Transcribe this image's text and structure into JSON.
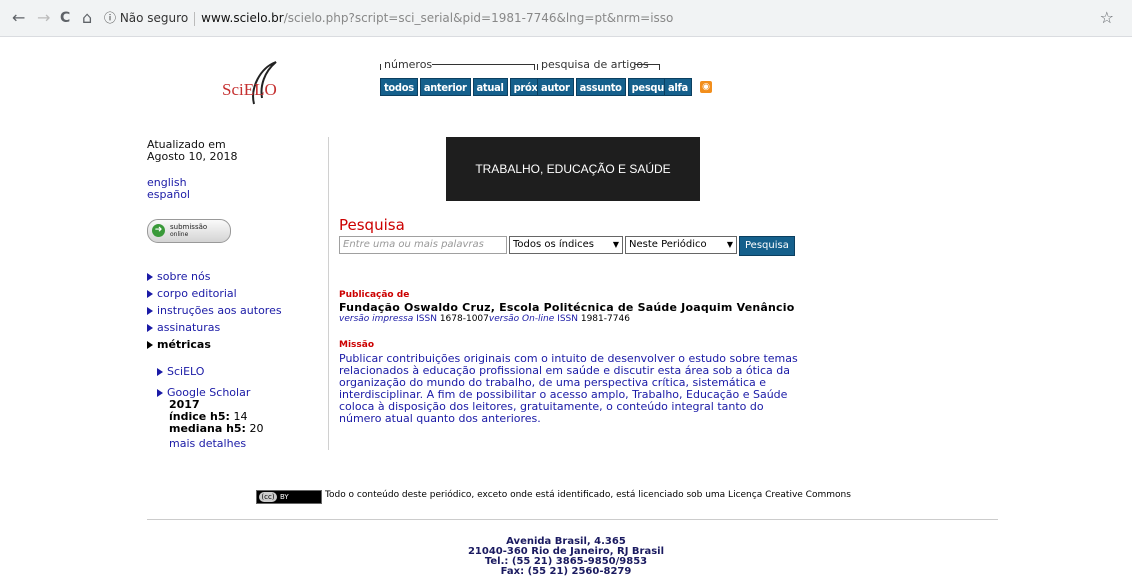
{
  "browser": {
    "back": "←",
    "forward": "→",
    "reload": "C",
    "home": "⌂",
    "security": "ⓘ Não seguro",
    "url_host": "www.scielo.br",
    "url_path": "/scielo.php?script=sci_serial&pid=1981-7746&lng=pt&nrm=isso",
    "star": "☆"
  },
  "logo": {
    "text": "SciELO"
  },
  "nav": {
    "group1_label": "números",
    "group2_label": "pesquisa de artigos",
    "group1": [
      "todos",
      "anterior",
      "atual",
      "próximo"
    ],
    "group2": [
      "autor",
      "assunto",
      "pesquisa"
    ],
    "alfa": "alfa"
  },
  "sidebar": {
    "updated_label": "Atualizado em",
    "updated_date": "Agosto 10, 2018",
    "lang_en": "english",
    "lang_es": "español",
    "submission_line1": "submissão",
    "submission_line2": "online",
    "menu": [
      "sobre nós",
      "corpo editorial",
      "instruções aos autores",
      "assinaturas",
      "métricas"
    ],
    "metrics": {
      "scielo": "SciELO",
      "google": "Google Scholar",
      "year": "2017",
      "h5_label": "índice h5:",
      "h5_value": " 14",
      "median_label": "mediana h5:",
      "median_value": " 20",
      "more": "mais detalhes"
    }
  },
  "banner": {
    "title": "TRABALHO, EDUCAÇÃO E SAÚDE"
  },
  "search": {
    "title": "Pesquisa",
    "placeholder": "Entre uma ou mais palavras",
    "index_select": "Todos os índices",
    "scope_select": "Neste Periódico",
    "button": "Pesquisa"
  },
  "publication": {
    "heading": "Publicação de",
    "publisher": "Fundação Oswaldo Cruz, Escola Politécnica de Saúde Joaquim Venâncio",
    "print_label": "versão impressa",
    "issn_word": "ISSN",
    "print_issn": "1678-1007",
    "online_label": "versão On-line",
    "online_issn": "1981-7746"
  },
  "mission": {
    "heading": "Missão",
    "text": "Publicar contribuições originais com o intuito de desenvolver o estudo sobre temas relacionados à educação profissional em saúde e discutir esta área sob a ótica da organização do mundo do trabalho, de uma perspectiva crítica, sistemática e interdisciplinar. A fim de possibilitar o acesso amplo, Trabalho, Educação e Saúde coloca à disposição dos leitores, gratuitamente, o conteúdo integral tanto do número atual quanto dos anteriores."
  },
  "license": {
    "badge_cc": "(cc)",
    "badge_by": "BY",
    "text": "Todo o conteúdo deste periódico, exceto onde está identificado, está licenciado sob uma Licença Creative Commons"
  },
  "footer": {
    "line1": "Avenida Brasil, 4.365",
    "line2": "21040-360 Rio de Janeiro, RJ Brasil",
    "line3": "Tel.: (55 21) 3865-9850/9853",
    "line4": "Fax: (55 21) 2560-8279"
  }
}
